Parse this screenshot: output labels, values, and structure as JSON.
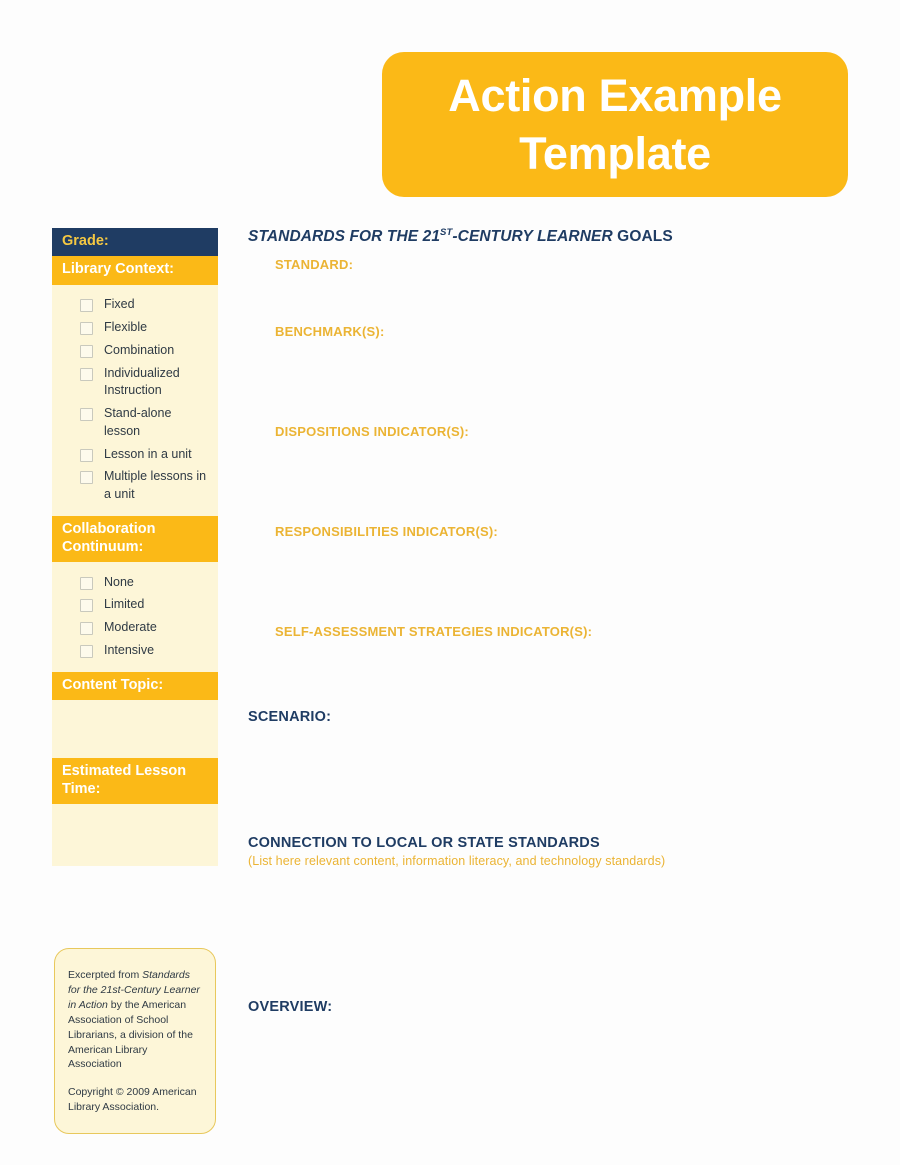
{
  "title_banner": {
    "line1": "Action Example",
    "line2": "Template",
    "bg_color": "#fbb917",
    "text_color": "#ffffff"
  },
  "sidebar": {
    "sections": [
      {
        "header": "Grade:",
        "style": "navy",
        "options": [],
        "blank": false
      },
      {
        "header": "Library Context:",
        "style": "gold",
        "options": [
          "Fixed",
          "Flexible",
          "Combination",
          "Individualized Instruction",
          "Stand-alone lesson",
          "Lesson in a unit",
          "Multiple lessons in a unit"
        ],
        "blank": false
      },
      {
        "header": "Collaboration Continuum:",
        "style": "gold",
        "options": [
          "None",
          "Limited",
          "Moderate",
          "Intensive"
        ],
        "blank": false
      },
      {
        "header": "Content Topic:",
        "style": "gold",
        "options": [],
        "blank": true
      },
      {
        "header": "Estimated Lesson Time:",
        "style": "gold",
        "options": [],
        "blank": true
      }
    ],
    "navy_bg": "#1f3c63",
    "navy_text": "#f5c842",
    "gold_bg": "#fbb917",
    "gold_text": "#ffffff",
    "panel_bg": "#fdf6d8"
  },
  "main": {
    "goals_heading": {
      "italic_part_a": "STANDARDS FOR THE 21",
      "superscript": "ST",
      "italic_part_b": "-CENTURY LEARNER",
      "upright_part": " GOALS"
    },
    "labels": {
      "standard": "STANDARD:",
      "benchmark": "BENCHMARK(S):",
      "dispositions": "DISPOSITIONS INDICATOR(S):",
      "responsibilities": "RESPONSIBILITIES INDICATOR(S):",
      "self_assessment": "SELF-ASSESSMENT STRATEGIES INDICATOR(S):",
      "scenario": "SCENARIO:",
      "connection": "CONNECTION TO LOCAL OR STATE STANDARDS",
      "connection_sub": "(List here relevant content, information literacy, and technology standards)",
      "overview": "OVERVIEW:"
    },
    "gold_label_color": "#ebb434",
    "navy_label_color": "#1f3c63"
  },
  "credit_box": {
    "excerpt_prefix": "Excerpted from ",
    "excerpt_title": "Standards for the 21st-Century Learner in Action",
    "excerpt_suffix": " by the American Association of School Librarians, a division of the American Library Association",
    "copyright": "Copyright © 2009 American Library Association.",
    "border_color": "#e8c85c",
    "bg_color": "#fdf6d8"
  }
}
